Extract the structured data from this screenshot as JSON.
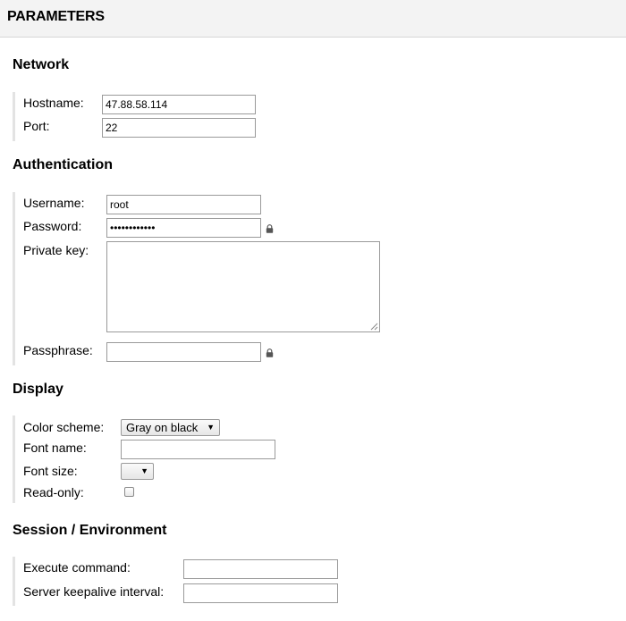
{
  "header": {
    "title": "PARAMETERS"
  },
  "network": {
    "title": "Network",
    "hostname_label": "Hostname:",
    "hostname_value": "47.88.58.114",
    "port_label": "Port:",
    "port_value": "22"
  },
  "authentication": {
    "title": "Authentication",
    "username_label": "Username:",
    "username_value": "root",
    "password_label": "Password:",
    "password_value": "••••••••••••",
    "private_key_label": "Private key:",
    "private_key_value": "",
    "passphrase_label": "Passphrase:",
    "passphrase_value": ""
  },
  "display": {
    "title": "Display",
    "color_scheme_label": "Color scheme:",
    "color_scheme_value": "Gray on black",
    "font_name_label": "Font name:",
    "font_name_value": "",
    "font_size_label": "Font size:",
    "font_size_value": "",
    "read_only_label": "Read-only:",
    "read_only_checked": false
  },
  "session": {
    "title": "Session / Environment",
    "execute_command_label": "Execute command:",
    "execute_command_value": "",
    "keepalive_label": "Server keepalive interval:",
    "keepalive_value": ""
  },
  "icons": {
    "password_lock": "lock-icon",
    "passphrase_lock": "lock-icon",
    "select_arrow": "triangle-down-icon"
  },
  "colors": {
    "header_bg": "#f3f3f3",
    "section_bar": "#e3e3e3",
    "field_border": "#9a9a9a"
  }
}
